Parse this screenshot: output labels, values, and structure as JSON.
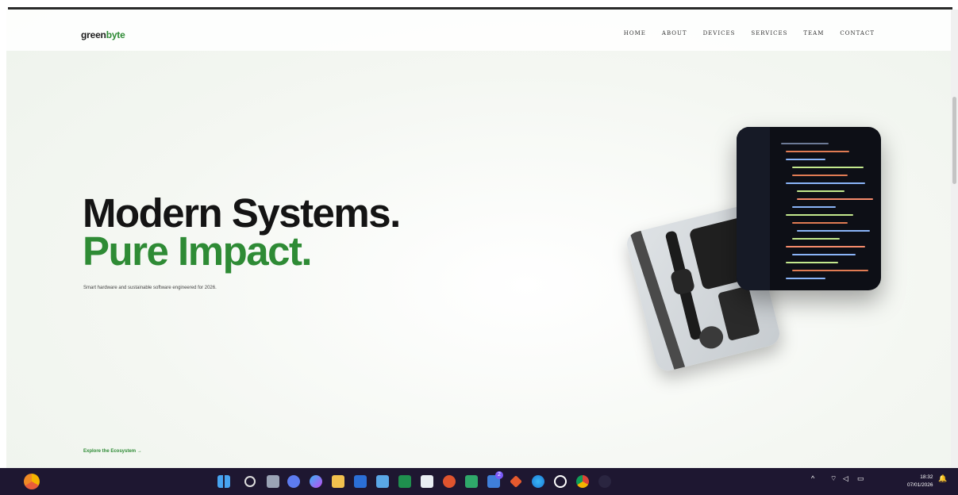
{
  "brand": {
    "prefix": "green",
    "suffix": "byte"
  },
  "nav": {
    "items": [
      "HOME",
      "ABOUT",
      "DEVICES",
      "SERVICES",
      "TEAM",
      "CONTACT"
    ]
  },
  "hero": {
    "line1": "Modern Systems.",
    "line2": "Pure Impact.",
    "subtitle": "Smart hardware and sustainable software engineered for 2026.",
    "cta": "Explore the Ecosystem →"
  },
  "colors": {
    "accent": "#2e8b35",
    "heading": "#141414",
    "taskbar": "#1e1731"
  },
  "taskbar": {
    "icons": [
      "chrome-canary-icon",
      "windows-start-icon",
      "search-icon",
      "taskview-icon",
      "chat-icon",
      "copilot-icon",
      "file-explorer-icon",
      "word-icon",
      "notepad-icon",
      "excel-icon",
      "store-icon",
      "app-icon",
      "screenshot-icon",
      "linkedin-icon",
      "gitlab-icon",
      "edge-icon",
      "whatsapp-icon",
      "chrome-icon",
      "obs-icon"
    ],
    "linkedin_badge": "2",
    "time": "18:32",
    "date": "07/01/2026"
  }
}
